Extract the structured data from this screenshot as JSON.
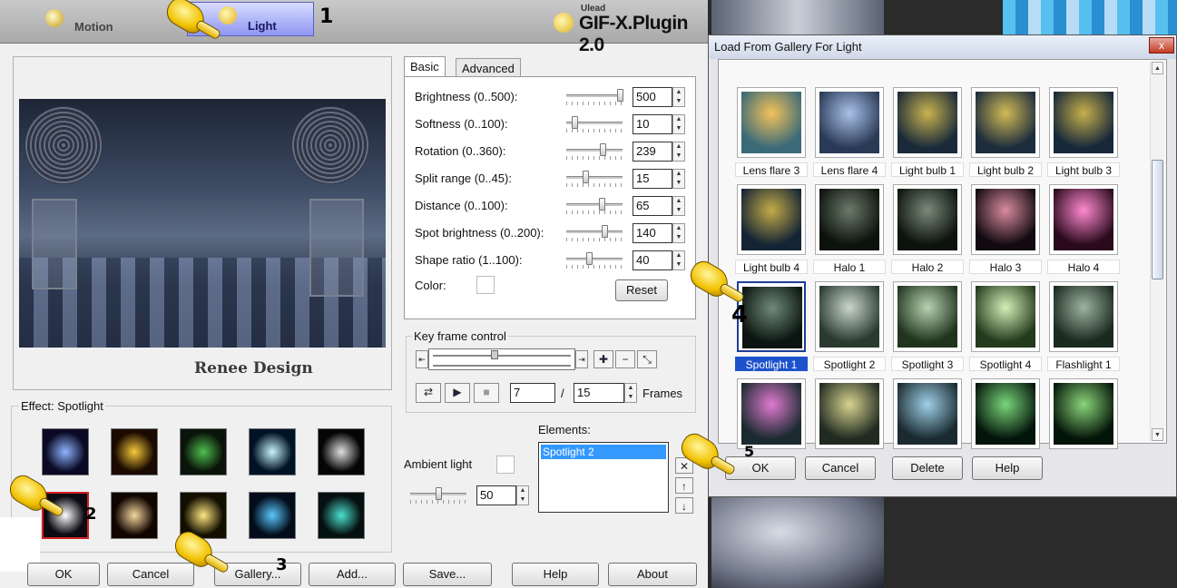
{
  "header": {
    "tabs": [
      {
        "label": "Motion",
        "active": false
      },
      {
        "label": "Light",
        "active": true
      }
    ],
    "brand_small": "Ulead",
    "brand_big": "GIF-X.Plugin 2.0"
  },
  "annotations": [
    "1",
    "2",
    "3",
    "4",
    "5"
  ],
  "preview": {
    "watermark": "Renee Design"
  },
  "effect": {
    "title": "Effect: Spotlight",
    "thumbs": [
      {
        "name": "lightning-effect",
        "colors": [
          "#8fb4ff",
          "#0a0a25"
        ]
      },
      {
        "name": "firework-effect",
        "colors": [
          "#f7c93a",
          "#1a0a00"
        ]
      },
      {
        "name": "lens-flare-effect",
        "colors": [
          "#4fbf4f",
          "#0a140a"
        ]
      },
      {
        "name": "starburst-effect",
        "colors": [
          "#c8f4ff",
          "#001226"
        ]
      },
      {
        "name": "ring-effect",
        "colors": [
          "#e0e0e0",
          "#050505"
        ]
      },
      {
        "name": "spotlight-effect",
        "colors": [
          "#ffffff",
          "#0b0b12"
        ]
      },
      {
        "name": "glow-effect",
        "colors": [
          "#f5d7a0",
          "#110500"
        ]
      },
      {
        "name": "comet-effect",
        "colors": [
          "#ffe680",
          "#120e00"
        ]
      },
      {
        "name": "beam-effect",
        "colors": [
          "#5ac8ff",
          "#020c1a"
        ]
      },
      {
        "name": "rainbow-effect",
        "colors": [
          "#4be0d0",
          "#051010"
        ]
      }
    ]
  },
  "settings": {
    "tabs": [
      "Basic",
      "Advanced"
    ],
    "params": [
      {
        "label": "Brightness (0..500):",
        "value": "500",
        "level": 1.0
      },
      {
        "label": "Softness (0..100):",
        "value": "10",
        "level": 0.1
      },
      {
        "label": "Rotation (0..360):",
        "value": "239",
        "level": 0.66
      },
      {
        "label": "Split range (0..45):",
        "value": "15",
        "level": 0.33
      },
      {
        "label": "Distance (0..100):",
        "value": "65",
        "level": 0.65
      },
      {
        "label": "Spot brightness (0..200):",
        "value": "140",
        "level": 0.7
      },
      {
        "label": "Shape ratio (1..100):",
        "value": "40",
        "level": 0.4
      }
    ],
    "color_label": "Color:",
    "reset_label": "Reset"
  },
  "keyframe": {
    "title": "Key frame control",
    "current_frame": "7",
    "separator": "/",
    "total_frames": "15",
    "frames_label": "Frames"
  },
  "ambient": {
    "label": "Ambient light",
    "value": "50",
    "level": 0.5
  },
  "elements": {
    "label": "Elements:",
    "items": [
      "Spotlight 2"
    ]
  },
  "buttons": {
    "ok": "OK",
    "cancel": "Cancel",
    "gallery": "Gallery...",
    "add": "Add...",
    "save": "Save...",
    "help": "Help",
    "about": "About"
  },
  "dialog": {
    "title": "Load From Gallery For Light",
    "close": "x",
    "items": [
      {
        "label": "Lens flare 3",
        "colors": [
          "#f4c25a",
          "#3b6a78"
        ]
      },
      {
        "label": "Lens flare 4",
        "colors": [
          "#a9c1e8",
          "#2a3a56"
        ]
      },
      {
        "label": "Light bulb 1",
        "colors": [
          "#c9b34f",
          "#1a2a3a"
        ]
      },
      {
        "label": "Light bulb 2",
        "colors": [
          "#d2bb55",
          "#1d2d3d"
        ]
      },
      {
        "label": "Light bulb 3",
        "colors": [
          "#c7b04b",
          "#17283a"
        ]
      },
      {
        "label": "Light bulb 4",
        "colors": [
          "#c5ac48",
          "#142434"
        ]
      },
      {
        "label": "Halo 1",
        "colors": [
          "#6c7a6a",
          "#0c120c"
        ]
      },
      {
        "label": "Halo 2",
        "colors": [
          "#7a8a7a",
          "#0c120c"
        ]
      },
      {
        "label": "Halo 3",
        "colors": [
          "#d98ba0",
          "#120a10"
        ]
      },
      {
        "label": "Halo 4",
        "colors": [
          "#ff8ad0",
          "#2a0a1c"
        ]
      },
      {
        "label": "Spotlight 1",
        "colors": [
          "#6f8a78",
          "#0a1410"
        ]
      },
      {
        "label": "Spotlight 2",
        "colors": [
          "#c9d6cc",
          "#2a3a30"
        ]
      },
      {
        "label": "Spotlight 3",
        "colors": [
          "#b8d2b0",
          "#20341e"
        ]
      },
      {
        "label": "Spotlight 4",
        "colors": [
          "#d6efb8",
          "#243a1c"
        ]
      },
      {
        "label": "Flashlight 1",
        "colors": [
          "#9fb3a0",
          "#1a2a1e"
        ]
      },
      {
        "label": "",
        "colors": [
          "#e07ad0",
          "#1a2a30"
        ]
      },
      {
        "label": "",
        "colors": [
          "#d7d48f",
          "#202a20"
        ]
      },
      {
        "label": "",
        "colors": [
          "#9fd0e8",
          "#1a2a30"
        ]
      },
      {
        "label": "",
        "colors": [
          "#7ad67a",
          "#03140a"
        ]
      },
      {
        "label": "",
        "colors": [
          "#8bd67a",
          "#031408"
        ]
      }
    ],
    "selected_index": 10,
    "buttons": {
      "ok": "OK",
      "cancel": "Cancel",
      "delete": "Delete",
      "help": "Help"
    }
  }
}
